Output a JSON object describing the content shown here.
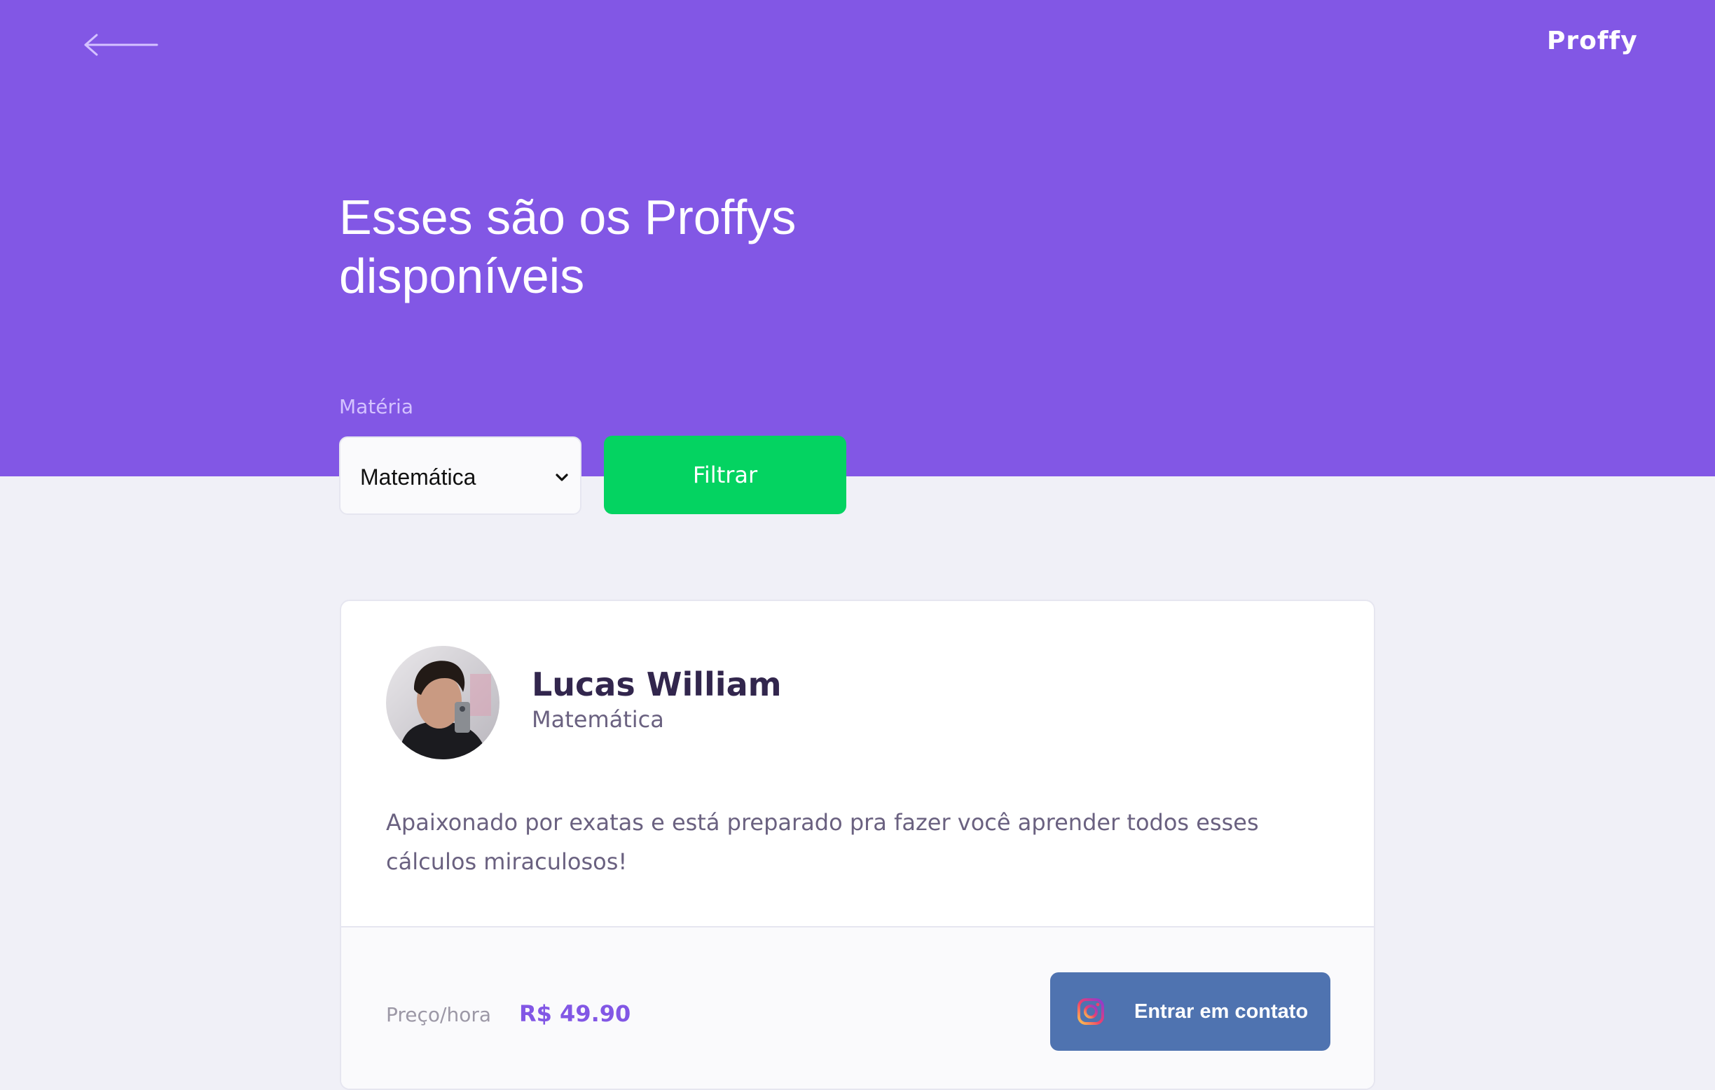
{
  "header": {
    "back_icon": "arrow-left-icon",
    "logo_text": "Proffy",
    "title": "Esses são os Proffys disponíveis"
  },
  "filter": {
    "label": "Matéria",
    "selected_subject": "Matemática",
    "button_label": "Filtrar"
  },
  "teacher_card": {
    "name": "Lucas William",
    "subject": "Matemática",
    "bio": "Apaixonado por exatas e está preparado pra fazer você aprender todos esses cálculos miraculosos!",
    "price_label": "Preço/hora",
    "price_value": "R$ 49.90",
    "contact_button_label": "Entrar em contato",
    "contact_icon": "instagram-icon"
  },
  "colors": {
    "primary": "#8257e5",
    "secondary": "#04d361",
    "background": "#f0f0f7",
    "contact_button": "#4f73b0",
    "title_text": "#32264d",
    "body_text": "#6a6180"
  }
}
